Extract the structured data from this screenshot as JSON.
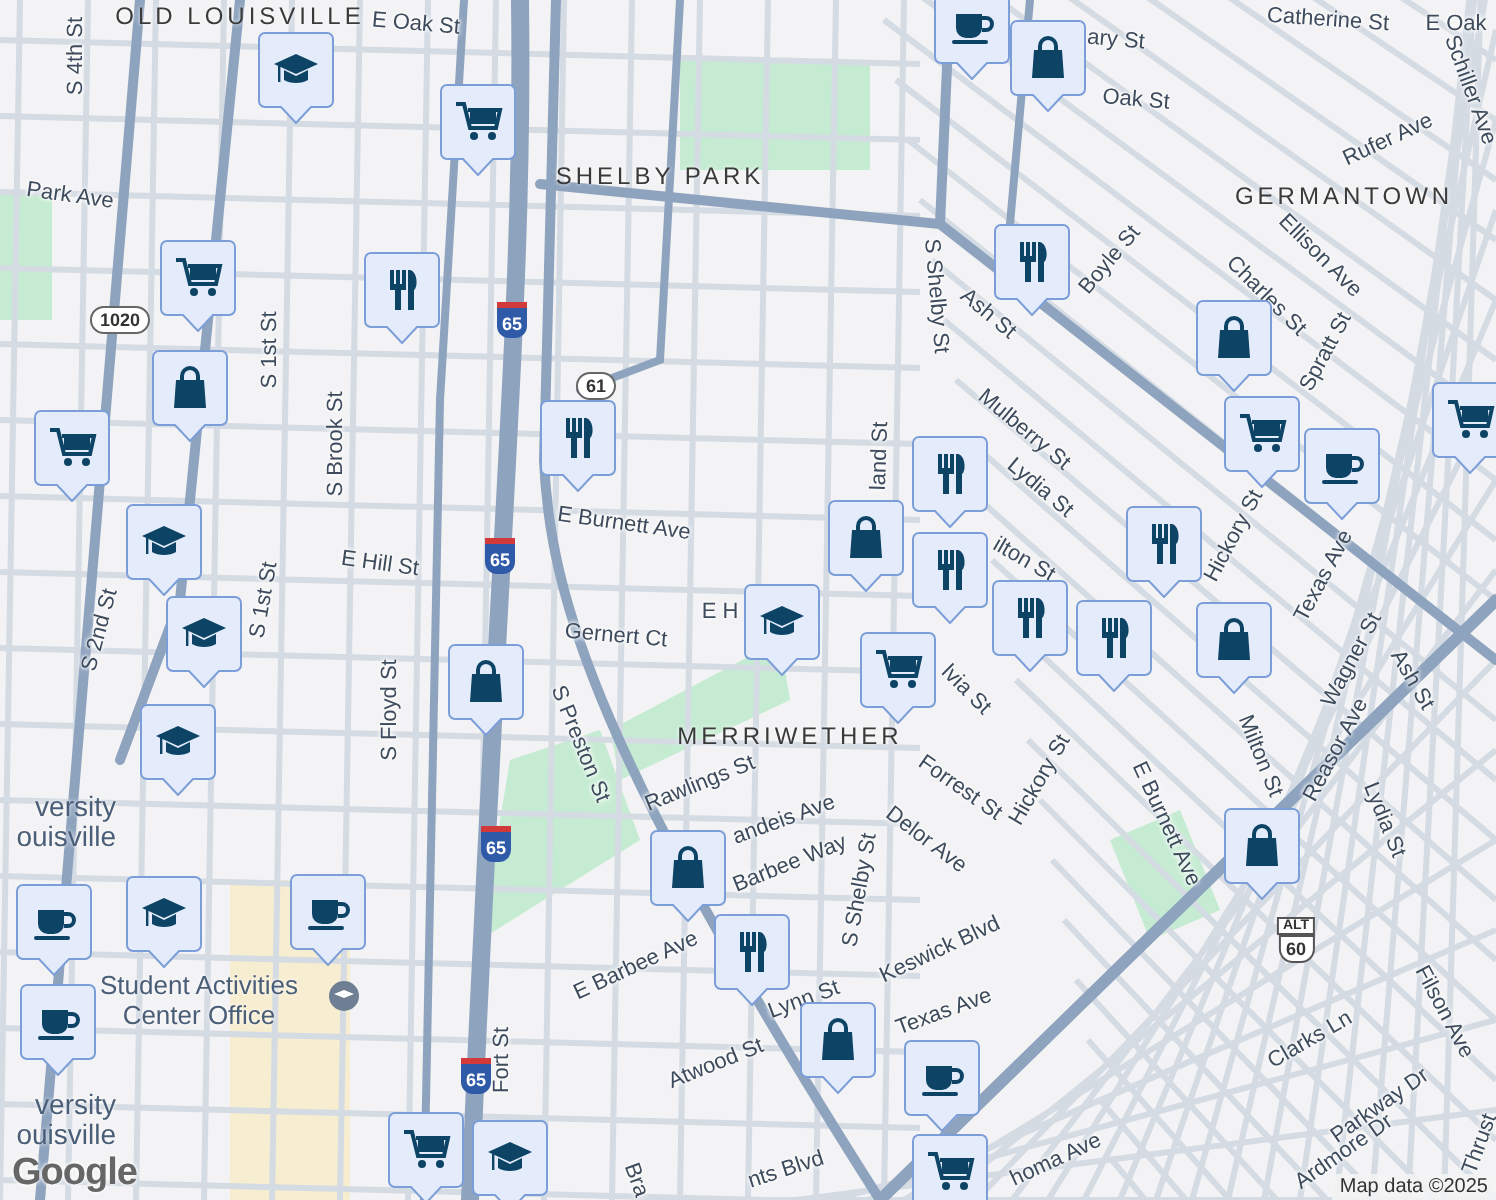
{
  "neighborhoods": [
    "OLD LOUISVILLE",
    "SHELBY PARK",
    "GERMANTOWN",
    "MERRIWETHER"
  ],
  "street_labels": [
    "S 4th St",
    "E Oak St",
    "Park Ave",
    "S 1st St",
    "S Brook St",
    "E Burnett Ave",
    "E Hill St",
    "S 2nd St",
    "S 1st St",
    "Gernert Ct",
    "S Floyd St",
    "S Preston St",
    "Rawlings St",
    "E Barbee Ave",
    "Fort St",
    "Atwood St",
    "Catherine St",
    "ary St",
    "Oak St",
    "E Oak",
    "Rufer Ave",
    "Schiller Ave",
    "Boyle St",
    "S Shelby St",
    "Ash St",
    "Ellison Ave",
    "Charles St",
    "Spratt St",
    "Mulberry St",
    "land St",
    "Lydia St",
    "ilton St",
    "Hickory St",
    "Texas Ave",
    "Wagner St",
    "Ash St",
    "Reasor Ave",
    "Milton St",
    "Lydia St",
    "E Burnett Ave",
    "lvia St",
    "Forrest St",
    "Hickory St",
    "Delor Ave",
    "andeis Ave",
    "Barbee Way",
    "S Shelby St",
    "Keswick Blvd",
    "Lynn St",
    "Texas Ave",
    "Clarks Ln",
    "Filson Ave",
    "Parkway Dr",
    "Ardmore Dr",
    "homa Ave",
    "nts Blvd",
    "E H",
    "Bra",
    "Thrust"
  ],
  "campus_labels": [
    "versity\nouisville",
    "versity\nouisville"
  ],
  "poi": {
    "label": "Student Activities\nCenter Office"
  },
  "shields": [
    {
      "kind": "state",
      "text": "1020"
    },
    {
      "kind": "interstate",
      "text": "65"
    },
    {
      "kind": "state",
      "text": "61"
    },
    {
      "kind": "interstate",
      "text": "65"
    },
    {
      "kind": "interstate",
      "text": "65"
    },
    {
      "kind": "interstate",
      "text": "65"
    },
    {
      "kind": "us",
      "text": "60",
      "badge": "ALT"
    }
  ],
  "pins": [
    {
      "kind": "school"
    },
    {
      "kind": "cart"
    },
    {
      "kind": "food"
    },
    {
      "kind": "cart"
    },
    {
      "kind": "bag"
    },
    {
      "kind": "cart"
    },
    {
      "kind": "school"
    },
    {
      "kind": "food"
    },
    {
      "kind": "coffee"
    },
    {
      "kind": "bag"
    },
    {
      "kind": "food"
    },
    {
      "kind": "bag"
    },
    {
      "kind": "cart"
    },
    {
      "kind": "coffee"
    },
    {
      "kind": "cart"
    },
    {
      "kind": "food"
    },
    {
      "kind": "food"
    },
    {
      "kind": "bag"
    },
    {
      "kind": "food"
    },
    {
      "kind": "school"
    },
    {
      "kind": "cart"
    },
    {
      "kind": "food"
    },
    {
      "kind": "food"
    },
    {
      "kind": "bag"
    },
    {
      "kind": "school"
    },
    {
      "kind": "school"
    },
    {
      "kind": "school"
    },
    {
      "kind": "coffee"
    },
    {
      "kind": "coffee"
    },
    {
      "kind": "coffee"
    },
    {
      "kind": "bag"
    },
    {
      "kind": "bag"
    },
    {
      "kind": "food"
    },
    {
      "kind": "bag"
    },
    {
      "kind": "coffee"
    },
    {
      "kind": "cart"
    },
    {
      "kind": "bag"
    },
    {
      "kind": "cart"
    },
    {
      "kind": "school"
    }
  ],
  "logo": "Google",
  "attribution": "Map data ©2025"
}
